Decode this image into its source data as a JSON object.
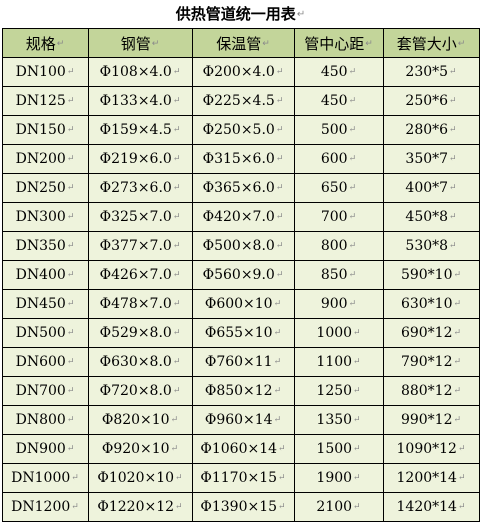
{
  "title": "供热管道统一用表",
  "return_mark": "↵",
  "headers": [
    "规格",
    "钢管",
    "保温管",
    "管中心距",
    "套管大小"
  ],
  "rows": [
    [
      "DN100",
      "Φ108×4.0",
      "Φ200×4.0",
      "450",
      "230*5"
    ],
    [
      "DN125",
      "Φ133×4.0",
      "Φ225×4.5",
      "450",
      "250*6"
    ],
    [
      "DN150",
      "Φ159×4.5",
      "Φ250×5.0",
      "500",
      "280*6"
    ],
    [
      "DN200",
      "Φ219×6.0",
      "Φ315×6.0",
      "600",
      "350*7"
    ],
    [
      "DN250",
      "Φ273×6.0",
      "Φ365×6.0",
      "650",
      "400*7"
    ],
    [
      "DN300",
      "Φ325×7.0",
      "Φ420×7.0",
      "700",
      "450*8"
    ],
    [
      "DN350",
      "Φ377×7.0",
      "Φ500×8.0",
      "800",
      "530*8"
    ],
    [
      "DN400",
      "Φ426×7.0",
      "Φ560×9.0",
      "850",
      "590*10"
    ],
    [
      "DN450",
      "Φ478×7.0",
      "Φ600×10",
      "900",
      "630*10"
    ],
    [
      "DN500",
      "Φ529×8.0",
      "Φ655×10",
      "1000",
      "690*12"
    ],
    [
      "DN600",
      "Φ630×8.0",
      "Φ760×11",
      "1100",
      "790*12"
    ],
    [
      "DN700",
      "Φ720×8.0",
      "Φ850×12",
      "1250",
      "880*12"
    ],
    [
      "DN800",
      "Φ820×10",
      "Φ960×14",
      "1350",
      "990*12"
    ],
    [
      "DN900",
      "Φ920×10",
      "Φ1060×14",
      "1500",
      "1090*12"
    ],
    [
      "DN1000",
      "Φ1020×10",
      "Φ1170×15",
      "1900",
      "1200*14"
    ],
    [
      "DN1200",
      "Φ1220×12",
      "Φ1390×15",
      "2100",
      "1420*14"
    ]
  ],
  "colors": {
    "header_bg": "#c3d59a",
    "body_bg": "#eef3dc",
    "border": "#000000",
    "mark": "#8a8a8a"
  }
}
